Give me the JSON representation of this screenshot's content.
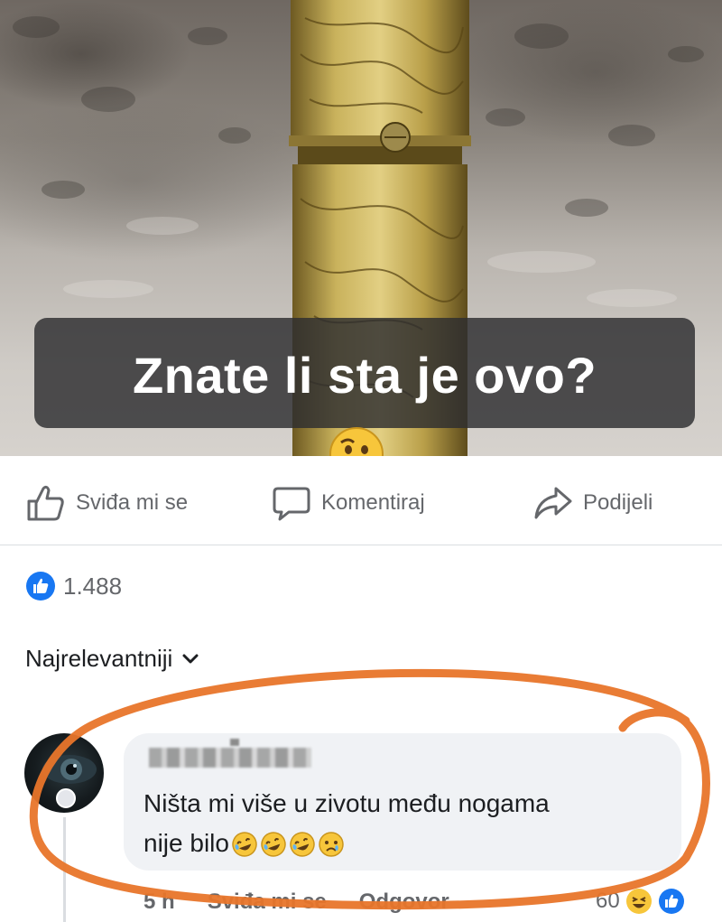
{
  "post": {
    "caption": "Znate li sta je ovo?",
    "caption_emoji": "thinking-face-emoji"
  },
  "actions": {
    "like_label": "Sviđa mi se",
    "comment_label": "Komentiraj",
    "share_label": "Podijeli"
  },
  "reactions": {
    "count": "1.488",
    "icon": "like-reaction-icon"
  },
  "sort": {
    "label": "Najrelevantniji",
    "icon": "chevron-down-icon"
  },
  "comment": {
    "text_line1": "Ništa mi više u zivotu među nogama",
    "text_line2": "nije bilo",
    "emojis": [
      "rolling-laughing-emoji",
      "rolling-laughing-emoji",
      "rolling-laughing-emoji",
      "sad-face-emoji"
    ],
    "time": "5 h",
    "like_label": "Sviđa mi se",
    "reply_label": "Odgovor",
    "reaction_count": "60"
  },
  "colors": {
    "overlay_circle": "#e8752a",
    "facebook_blue": "#1877f2",
    "secondary_text": "#65676b",
    "bubble_bg": "#f0f2f5"
  }
}
